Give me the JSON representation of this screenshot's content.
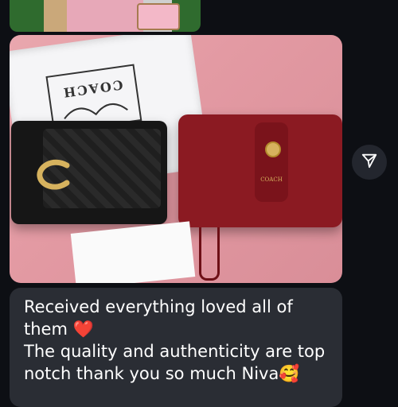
{
  "top_photo": {},
  "message_photo": {
    "dust_bag_brand": "COACH",
    "red_bag_brand": "COACH"
  },
  "forward_button": {
    "icon": "send-icon"
  },
  "message": {
    "lines": [
      "Received everything loved all of",
      "them",
      "The quality and authenticity are top",
      "notch thank you so much Niva"
    ],
    "heart_emoji": "❤️",
    "smile_emoji": "🥰"
  },
  "colors": {
    "background": "#0d0f14",
    "bubble": "#2a2d34",
    "text": "#ffffff",
    "forward_button_bg": "#23262e"
  }
}
